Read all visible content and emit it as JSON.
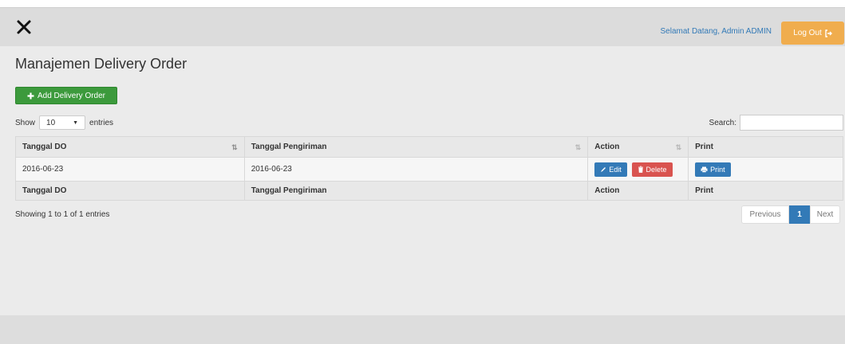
{
  "navbar": {
    "close_icon": "close-icon",
    "welcome": "Selamat Datang, Admin ADMIN",
    "logout_label": "Log Out",
    "logout_icon": "sign-out-icon",
    "logout_color": "#f0ad4e"
  },
  "page": {
    "title": "Manajemen Delivery Order",
    "add_button": "Add Delivery Order",
    "add_button_color": "#3c9a3c"
  },
  "length_control": {
    "show_label": "Show",
    "selected": "10",
    "entries_label": "entries"
  },
  "search": {
    "label": "Search:",
    "value": ""
  },
  "table": {
    "headers": [
      "Tanggal DO",
      "Tanggal Pengiriman",
      "Action",
      "Print"
    ],
    "rows": [
      {
        "tanggal_do": "2016-06-23",
        "tanggal_pengiriman": "2016-06-23",
        "edit_label": "Edit",
        "delete_label": "Delete",
        "print_label": "Print"
      }
    ],
    "footers": [
      "Tanggal DO",
      "Tanggal Pengiriman",
      "Action",
      "Print"
    ]
  },
  "info": "Showing 1 to 1 of 1 entries",
  "pagination": {
    "previous": "Previous",
    "current": "1",
    "next": "Next"
  }
}
